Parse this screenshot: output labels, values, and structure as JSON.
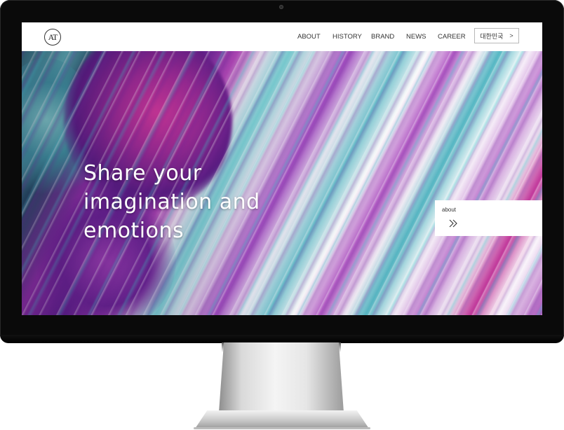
{
  "site": {
    "logo_text": "AT",
    "nav": [
      {
        "label": "ABOUT"
      },
      {
        "label": "HISTORY"
      },
      {
        "label": "BRAND"
      },
      {
        "label": "NEWS"
      },
      {
        "label": "CAREER"
      }
    ],
    "language_button": {
      "label": "대한민국",
      "arrow": ">"
    }
  },
  "hero": {
    "headline_lines": [
      "Share your",
      "imagination and",
      "emotions"
    ],
    "about_card": {
      "label": "about",
      "icon": "double-chevron-right-icon"
    }
  },
  "colors": {
    "monitor_bezel": "#0a0a0a",
    "header_bg": "#ffffff",
    "headline_text": "#ffffff",
    "nav_text": "#333333"
  }
}
